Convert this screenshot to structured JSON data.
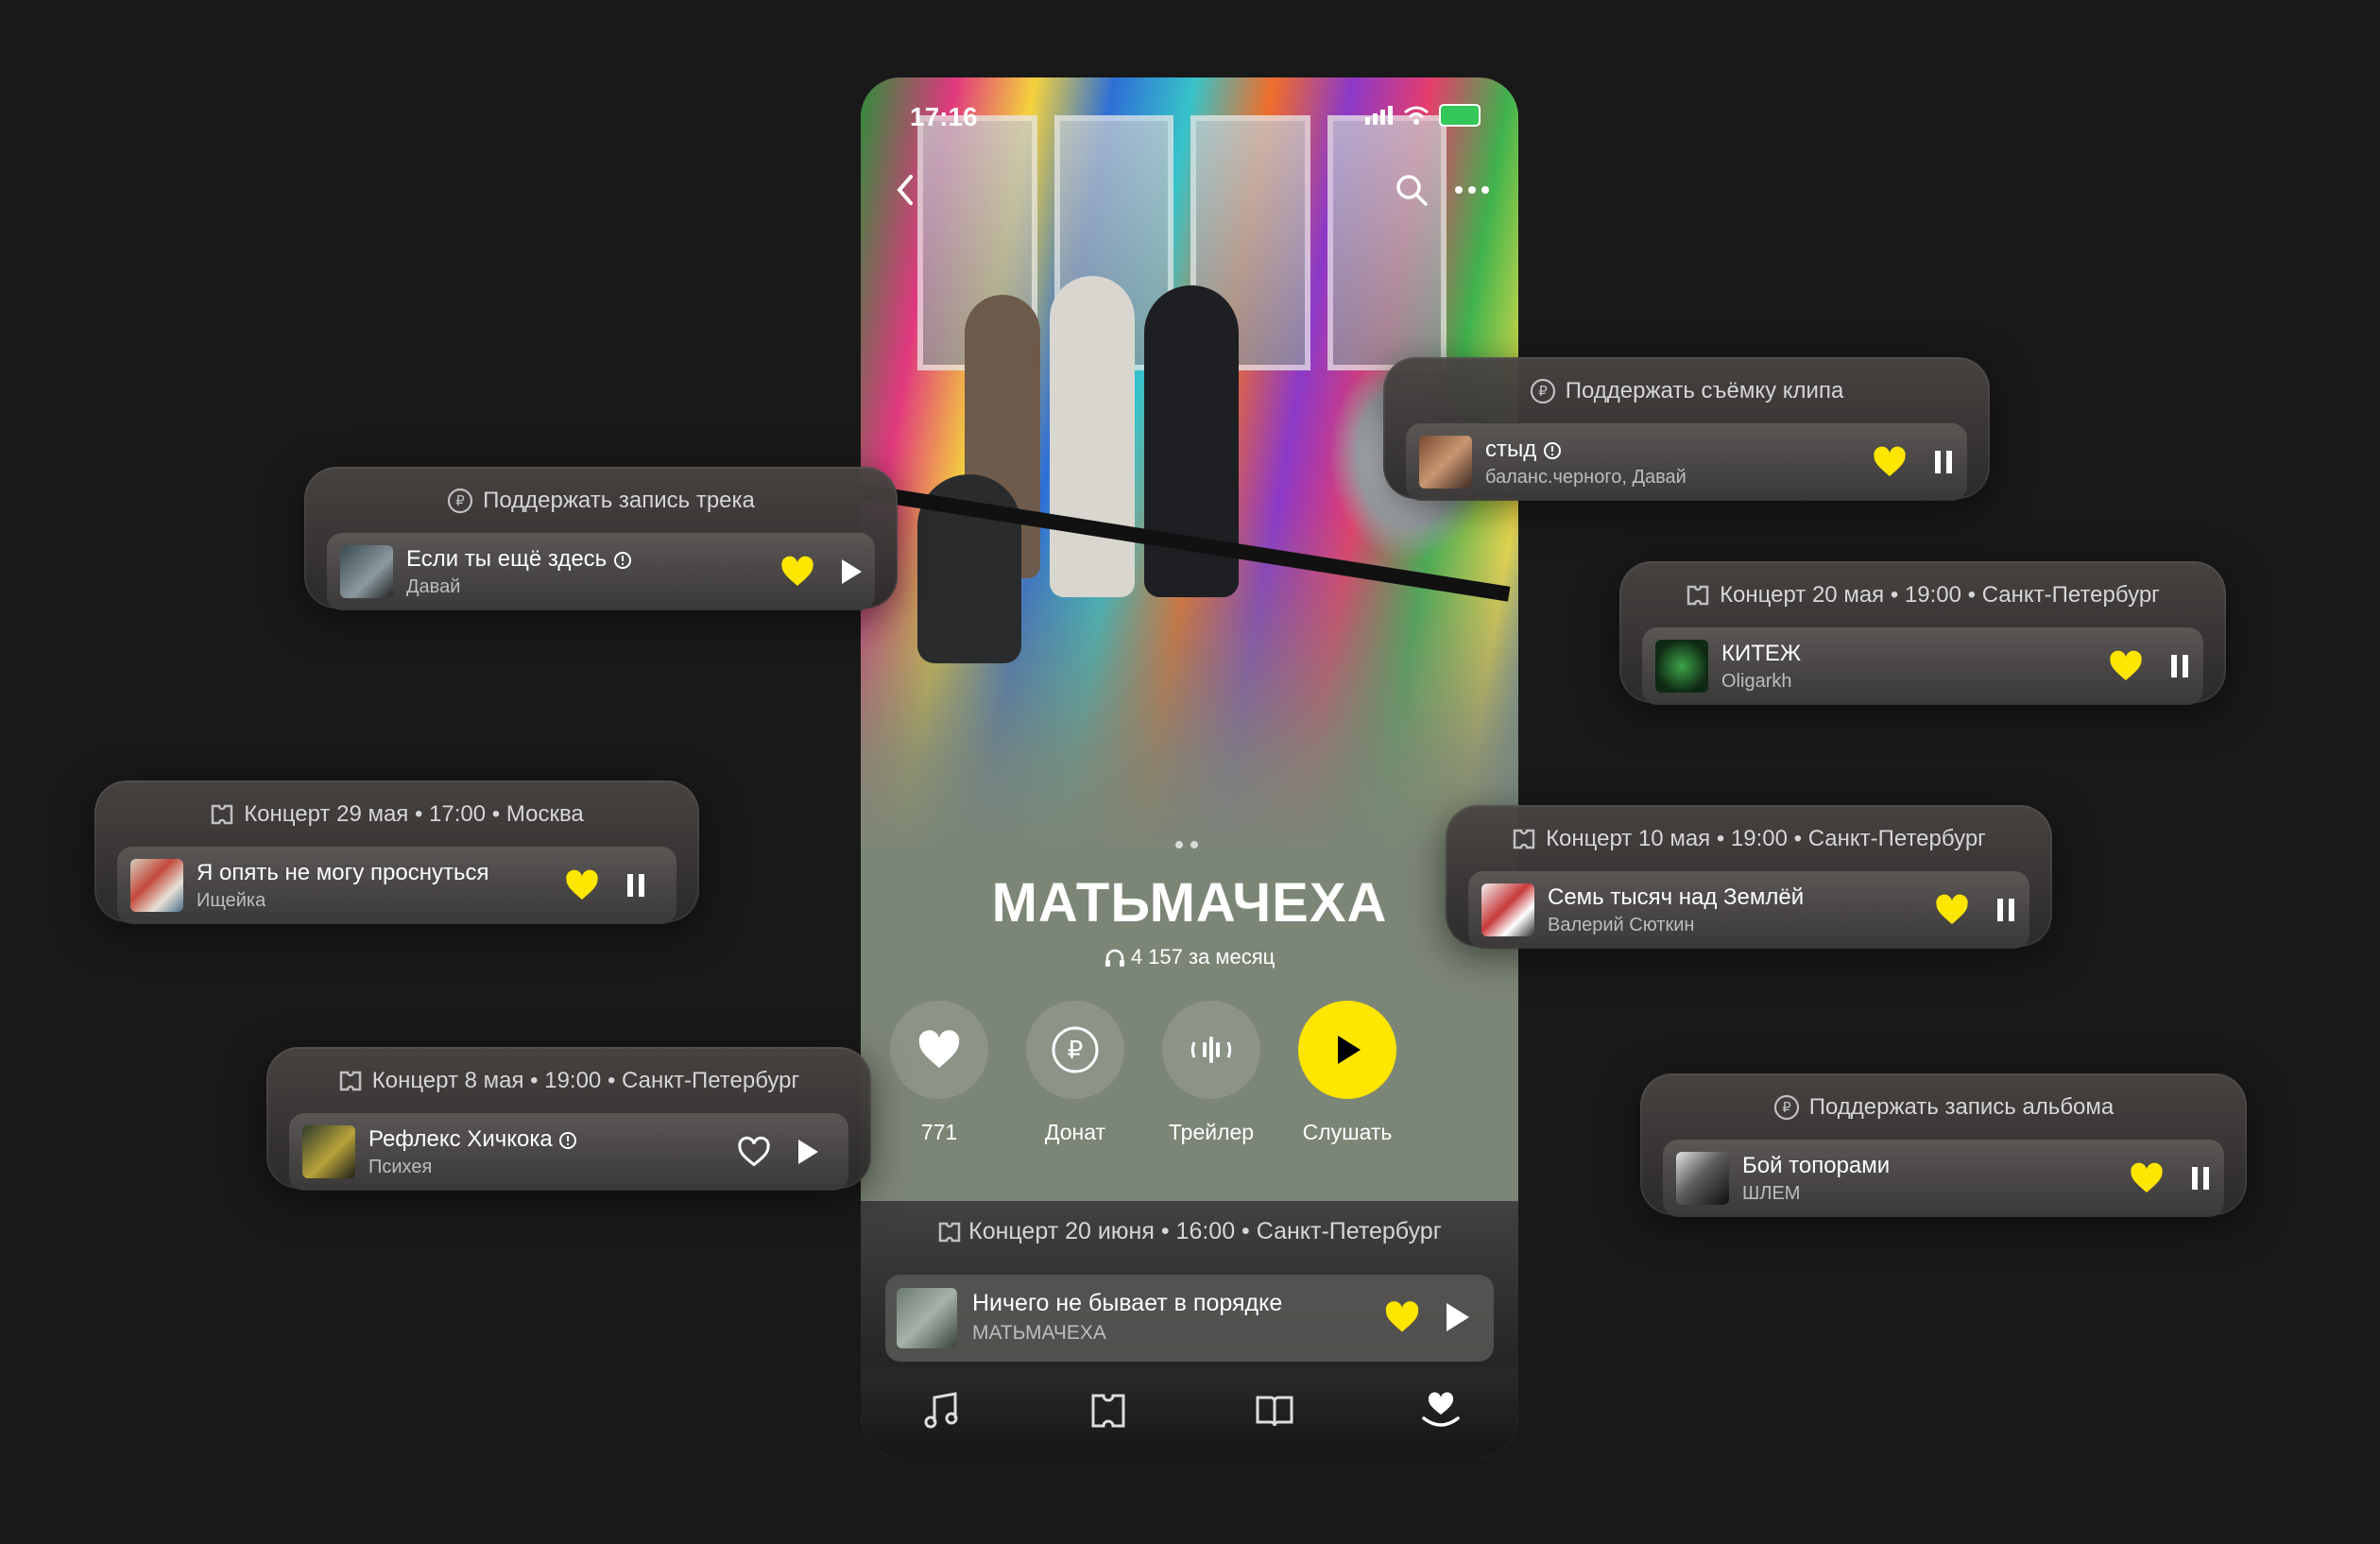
{
  "status_bar": {
    "time": "17:16"
  },
  "artist": {
    "name": "МАТЬМАЧЕХА",
    "listeners": "4 157 за месяц"
  },
  "actions": [
    {
      "label": "771",
      "icon": "heart-icon"
    },
    {
      "label": "Донат",
      "icon": "ruble-icon"
    },
    {
      "label": "Трейлер",
      "icon": "waveform-icon"
    },
    {
      "label": "Слушать",
      "icon": "play-icon"
    }
  ],
  "phone_card": {
    "header": "Концерт 20 июня • 16:00 • Санкт-Петербург",
    "title": "Ничего не бывает в порядке",
    "artist": "МАТЬМАЧЕХА",
    "liked": true,
    "state": "play"
  },
  "tabbar": [
    "music-note-icon",
    "ticket-icon",
    "book-icon",
    "heart-hand-icon"
  ],
  "cards": [
    {
      "header": "Поддержать запись трека",
      "header_icon": "ruble-icon",
      "title": "Если ты ещё здесь",
      "explicit": true,
      "artist": "Давай",
      "liked": true,
      "state": "play"
    },
    {
      "header": "Поддержать съёмку клипа",
      "header_icon": "ruble-icon",
      "title": "стыд",
      "explicit": true,
      "artist": "баланс.черного, Давай",
      "liked": true,
      "state": "pause"
    },
    {
      "header": "Концерт 20 мая • 19:00 • Санкт-Петербург",
      "header_icon": "ticket-icon",
      "title": "КИТЕЖ",
      "explicit": false,
      "artist": "Oligarkh",
      "liked": true,
      "state": "pause"
    },
    {
      "header": "Концерт 29 мая • 17:00 • Москва",
      "header_icon": "ticket-icon",
      "title": "Я опять не могу проснуться",
      "explicit": false,
      "artist": "Ищейка",
      "liked": true,
      "state": "pause"
    },
    {
      "header": "Концерт 10 мая • 19:00 • Санкт-Петербург",
      "header_icon": "ticket-icon",
      "title": "Семь тысяч над Землёй",
      "explicit": false,
      "artist": "Валерий Сюткин",
      "liked": true,
      "state": "pause"
    },
    {
      "header": "Концерт 8 мая • 19:00 • Санкт-Петербург",
      "header_icon": "ticket-icon",
      "title": "Рефлекс Хичкока",
      "explicit": true,
      "artist": "Психея",
      "liked": false,
      "state": "play"
    },
    {
      "header": "Поддержать запись альбома",
      "header_icon": "ruble-icon",
      "title": "Бой топорами",
      "explicit": false,
      "artist": "ШЛЕМ",
      "liked": true,
      "state": "pause"
    }
  ],
  "colors": {
    "accent": "#ffe600",
    "background": "#191919",
    "phone_bg": "#7c8677"
  }
}
